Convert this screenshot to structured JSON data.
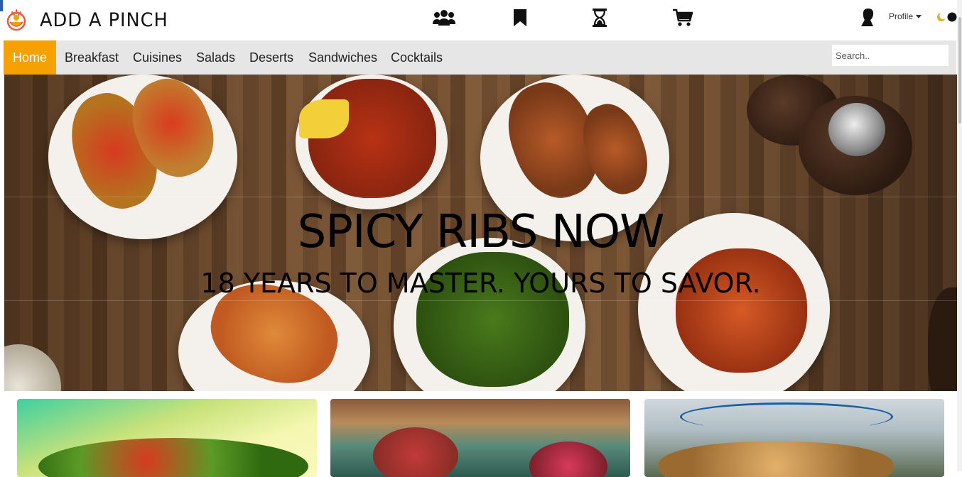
{
  "header": {
    "brand": "ADD A PINCH",
    "profile_label": "Profile",
    "icons": [
      "community-icon",
      "bookmark-icon",
      "hourglass-icon",
      "cart-icon"
    ]
  },
  "nav": {
    "items": [
      {
        "label": "Home",
        "active": true
      },
      {
        "label": "Breakfast"
      },
      {
        "label": "Cuisines"
      },
      {
        "label": "Salads"
      },
      {
        "label": "Deserts"
      },
      {
        "label": "Sandwiches"
      },
      {
        "label": "Cocktails"
      }
    ],
    "search_placeholder": "Search..",
    "active_color": "#f5a100"
  },
  "hero": {
    "title": "SPICY RIBS NOW",
    "subtitle": "18 YEARS TO MASTER. YOURS TO SAVOR."
  },
  "colors": {
    "accent": "#f5a100",
    "nav_bg": "#e6e6e6"
  }
}
